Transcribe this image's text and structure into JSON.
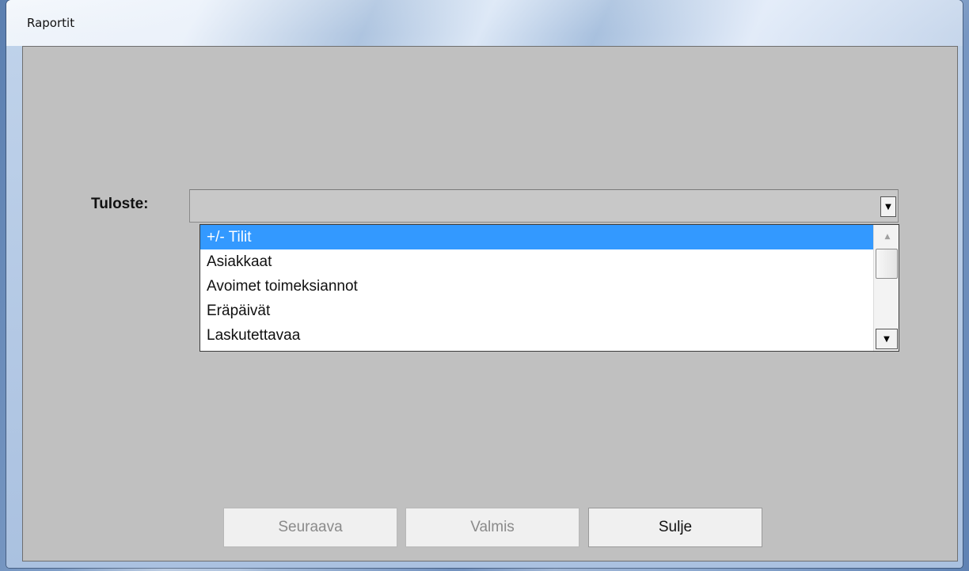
{
  "window": {
    "title": "Raportit"
  },
  "form": {
    "field_label": "Tuloste:",
    "combo_value": "",
    "dropdown_icon": "chevron-down-icon",
    "options": [
      {
        "label": "+/- Tilit",
        "selected": true
      },
      {
        "label": "Asiakkaat",
        "selected": false
      },
      {
        "label": "Avoimet toimeksiannot",
        "selected": false
      },
      {
        "label": "Eräpäivät",
        "selected": false
      },
      {
        "label": "Laskutettavaa",
        "selected": false
      }
    ]
  },
  "buttons": {
    "next_label": "Seuraava",
    "next_enabled": false,
    "finish_label": "Valmis",
    "finish_enabled": false,
    "close_label": "Sulje",
    "close_enabled": true
  },
  "colors": {
    "selection": "#3399ff",
    "client_bg": "#c0c0c0"
  }
}
